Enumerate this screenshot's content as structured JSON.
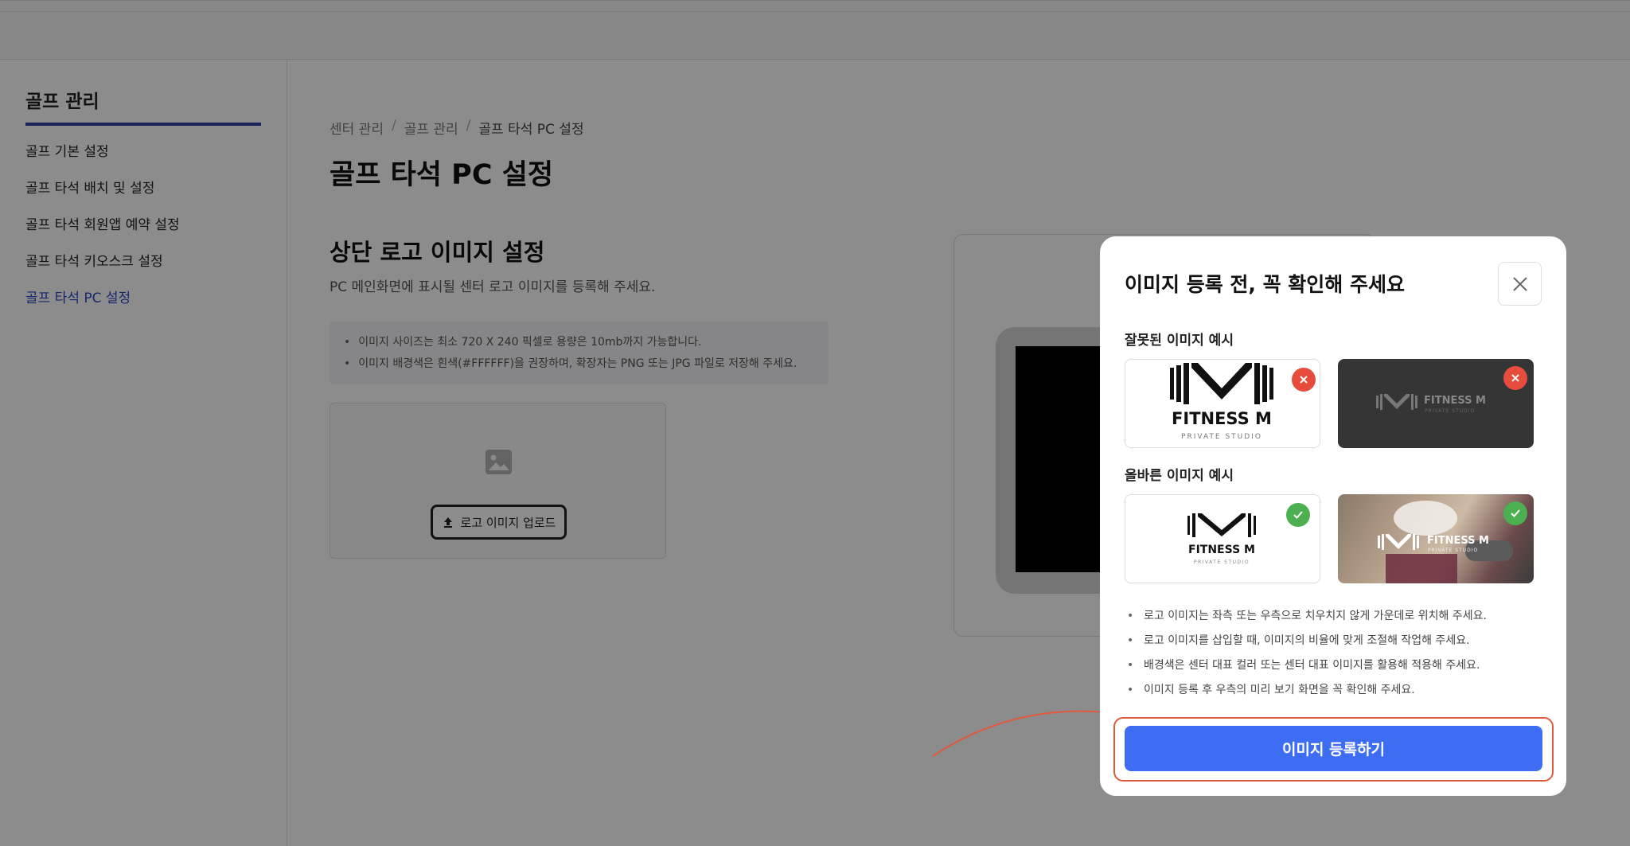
{
  "sidebar": {
    "title": "골프 관리",
    "items": [
      {
        "label": "골프 기본 설정"
      },
      {
        "label": "골프 타석 배치 및 설정"
      },
      {
        "label": "골프 타석 회원앱 예약 설정"
      },
      {
        "label": "골프 타석 키오스크 설정"
      },
      {
        "label": "골프 타석 PC 설정",
        "active": true
      }
    ]
  },
  "breadcrumb": [
    "센터 관리",
    "골프 관리",
    "골프 타석 PC 설정"
  ],
  "page_title": "골프 타석 PC 설정",
  "section": {
    "title": "상단 로고 이미지 설정",
    "description": "PC 메인화면에 표시될 센터 로고 이미지를 등록해 주세요.",
    "notices": [
      "이미지 사이즈는 최소 720 X 240 픽셀로 용량은 10mb까지 가능합니다.",
      "이미지 배경색은 흰색(#FFFFFF)을 권장하며, 확장자는 PNG 또는 JPG 파일로 저장해 주세요."
    ],
    "upload_button": "로고 이미지 업로드"
  },
  "modal": {
    "title": "이미지 등록 전, 꼭 확인해 주세요",
    "wrong_label": "잘못된 이미지 예시",
    "right_label": "올바른 이미지 예시",
    "logo": {
      "brand": "FITNESS M",
      "tagline": "PRIVATE STUDIO"
    },
    "guidelines": [
      "로고 이미지는 좌측 또는 우측으로 치우치지 않게 가운데로 위치해 주세요.",
      "로고 이미지를 삽입할 때, 이미지의 비율에 맞게 조절해 작업해 주세요.",
      "배경색은 센터 대표 컬러 또는 센터 대표 이미지를 활용해 적용해 주세요.",
      "이미지 등록 후 우측의 미리 보기 화면을 꼭 확인해 주세요."
    ],
    "register_button": "이미지 등록하기"
  },
  "colors": {
    "accent": "#3d6df2",
    "sidebar_active": "#2b48c4",
    "error_badge": "#e64b3c",
    "success_badge": "#4caf50",
    "annotation": "#e05a3c"
  }
}
